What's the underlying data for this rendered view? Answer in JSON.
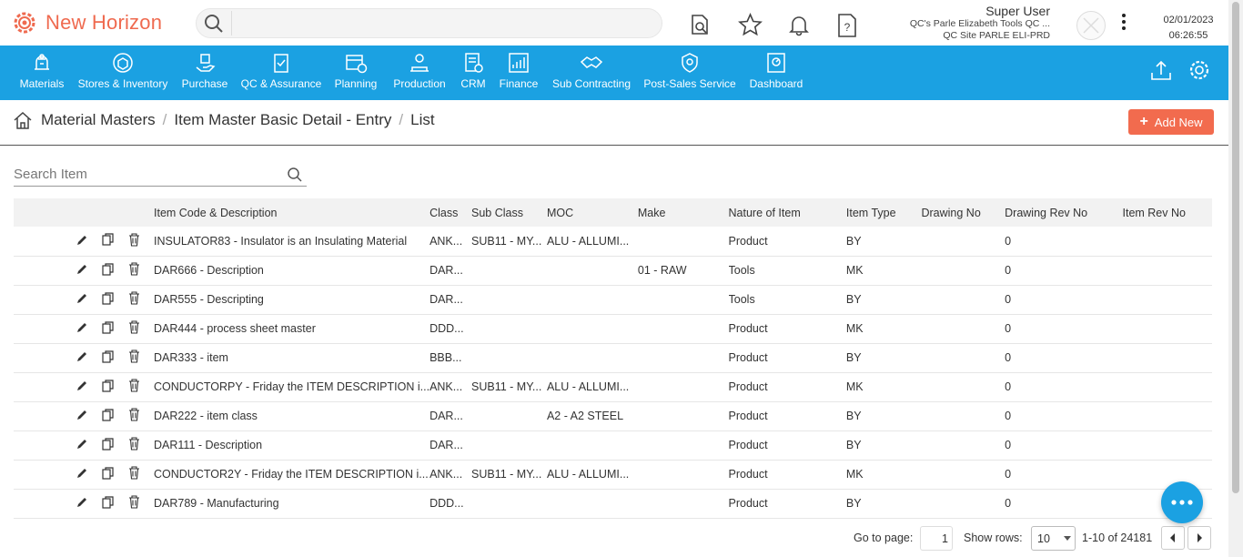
{
  "app": {
    "name": "New Horizon",
    "brand_color": "#ef6a4f",
    "nav_color": "#1ba1e2"
  },
  "search": {
    "placeholder": ""
  },
  "user": {
    "name": "Super User",
    "company": "QC's Parle Elizabeth Tools QC ...",
    "site": "QC Site PARLE ELI-PRD",
    "date": "02/01/2023",
    "time": "06:26:55"
  },
  "nav": [
    {
      "label": "Materials",
      "icon": "materials-icon"
    },
    {
      "label": "Stores & Inventory",
      "icon": "stores-icon"
    },
    {
      "label": "Purchase",
      "icon": "purchase-icon"
    },
    {
      "label": "QC & Assurance",
      "icon": "qc-icon"
    },
    {
      "label": "Planning",
      "icon": "planning-icon"
    },
    {
      "label": "Production",
      "icon": "production-icon"
    },
    {
      "label": "CRM",
      "icon": "crm-icon"
    },
    {
      "label": "Finance",
      "icon": "finance-icon"
    },
    {
      "label": "Sub Contracting",
      "icon": "subcontracting-icon"
    },
    {
      "label": "Post-Sales Service",
      "icon": "post-sales-icon"
    },
    {
      "label": "Dashboard",
      "icon": "dashboard-icon"
    }
  ],
  "breadcrumb": [
    "Material Masters",
    "Item Master Basic Detail - Entry",
    "List"
  ],
  "add_button": "Add New",
  "search_item": {
    "placeholder": "Search Item"
  },
  "table": {
    "columns": [
      "Item Code & Description",
      "Class",
      "Sub Class",
      "MOC",
      "Make",
      "Nature of Item",
      "Item Type",
      "Drawing No",
      "Drawing Rev No",
      "Item Rev No"
    ],
    "rows": [
      [
        "INSULATOR83 - Insulator is an Insulating Material",
        "ANK...",
        "SUB11 - MY...",
        "ALU - ALLUMI...",
        "",
        "Product",
        "BY",
        "",
        "0",
        ""
      ],
      [
        "DAR666 - Description",
        "DAR...",
        "",
        "",
        "01 - RAW",
        "Tools",
        "MK",
        "",
        "0",
        ""
      ],
      [
        "DAR555 - Descripting",
        "DAR...",
        "",
        "",
        "",
        "Tools",
        "BY",
        "",
        "0",
        ""
      ],
      [
        "DAR444 - process sheet master",
        "DDD...",
        "",
        "",
        "",
        "Product",
        "MK",
        "",
        "0",
        ""
      ],
      [
        "DAR333 - item",
        "BBB...",
        "",
        "",
        "",
        "Product",
        "BY",
        "",
        "0",
        ""
      ],
      [
        "CONDUCTORPY - Friday the ITEM DESCRIPTION i...",
        "ANK...",
        "SUB11 - MY...",
        "ALU - ALLUMI...",
        "",
        "Product",
        "MK",
        "",
        "0",
        ""
      ],
      [
        "DAR222 - item class",
        "DAR...",
        "",
        "A2 - A2 STEEL",
        "",
        "Product",
        "BY",
        "",
        "0",
        ""
      ],
      [
        "DAR111 - Description",
        "DAR...",
        "",
        "",
        "",
        "Product",
        "BY",
        "",
        "0",
        ""
      ],
      [
        "CONDUCTOR2Y - Friday the ITEM DESCRIPTION i...",
        "ANK...",
        "SUB11 - MY...",
        "ALU - ALLUMI...",
        "",
        "Product",
        "MK",
        "",
        "0",
        ""
      ],
      [
        "DAR789 - Manufacturing",
        "DDD...",
        "",
        "",
        "",
        "Product",
        "BY",
        "",
        "0",
        ""
      ]
    ]
  },
  "pager": {
    "goto_label": "Go to page:",
    "page": "1",
    "rows_label": "Show rows:",
    "rows": "10",
    "range": "1-10 of 24181"
  }
}
